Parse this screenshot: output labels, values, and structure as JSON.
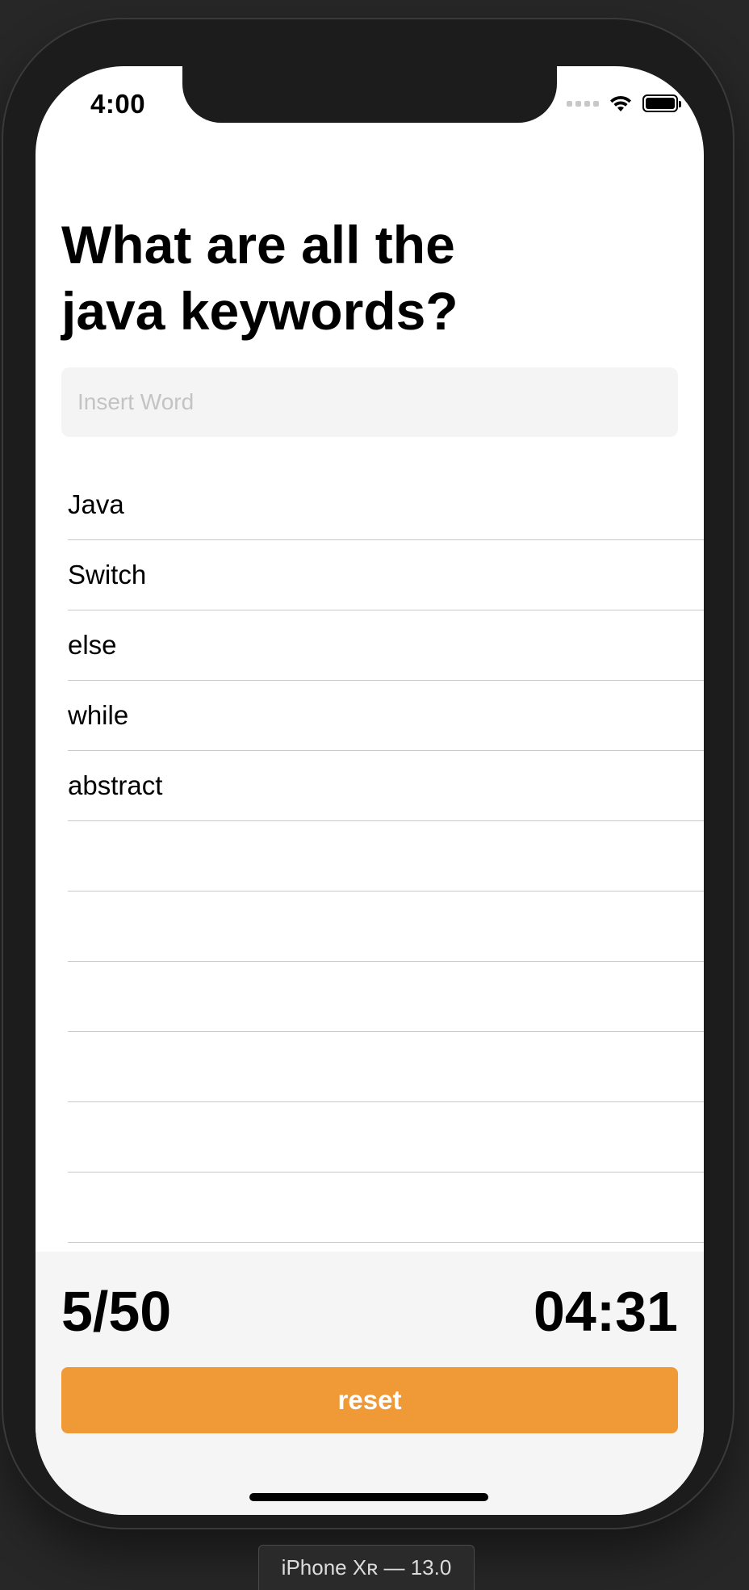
{
  "simulator": {
    "device_label": "iPhone Xʀ — 13.0"
  },
  "status_bar": {
    "time": "4:00",
    "icons": [
      "cellular-signal-icon",
      "wifi-icon",
      "battery-icon"
    ]
  },
  "question": {
    "title": "What are all the java keywords?"
  },
  "input": {
    "placeholder": "Insert Word",
    "value": ""
  },
  "answers": {
    "items": [
      "Java",
      "Switch",
      "else",
      "while",
      "abstract",
      "",
      "",
      "",
      "",
      "",
      ""
    ]
  },
  "footer": {
    "score": "5/50",
    "timer": "04:31",
    "reset_label": "reset"
  },
  "colors": {
    "accent": "#f09a37",
    "footer_bg": "#f5f5f5",
    "input_bg": "#f4f4f4",
    "separator": "#c8c7cc"
  }
}
